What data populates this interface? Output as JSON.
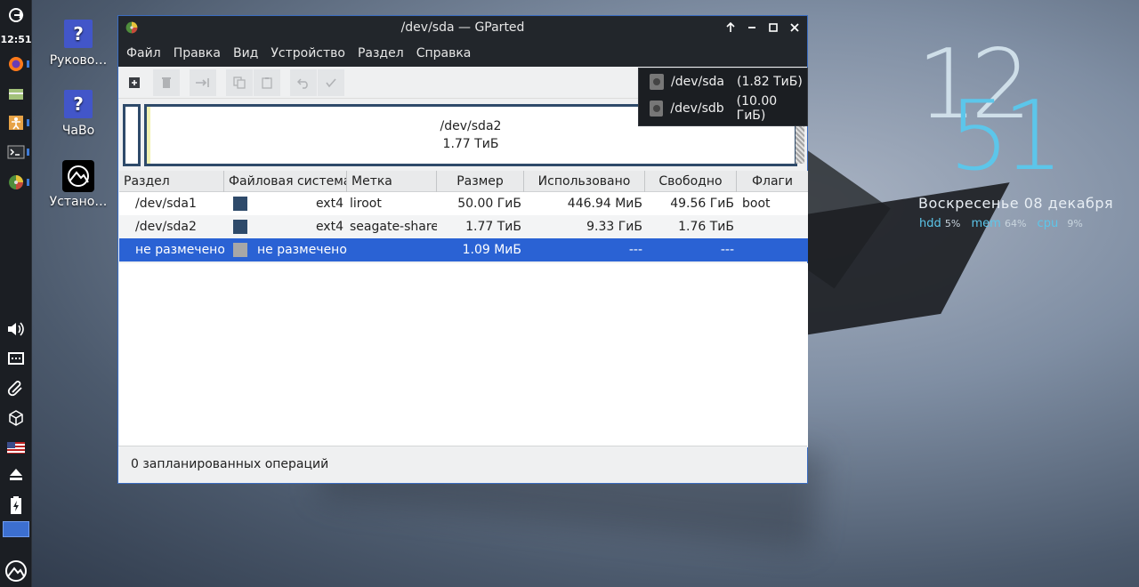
{
  "panel": {
    "clock": "12:51",
    "icons": [
      "logout-icon",
      "firefox-icon",
      "file-manager-icon",
      "accessibility-icon",
      "terminal-icon",
      "gparted-icon",
      "volume-icon",
      "network-icon",
      "clipboard-icon",
      "package-icon",
      "keyboard-layout-flag-icon",
      "eject-icon",
      "battery-icon",
      "workspace-icon",
      "distro-logo-icon"
    ]
  },
  "desktop": {
    "icons": [
      {
        "label": "Руково…",
        "icon": "help-icon"
      },
      {
        "label": "ЧаВо",
        "icon": "help-icon"
      },
      {
        "label": "Устано…",
        "icon": "installer-icon"
      }
    ]
  },
  "window": {
    "title": "/dev/sda — GParted",
    "menu": [
      "Файл",
      "Правка",
      "Вид",
      "Устройство",
      "Раздел",
      "Справка"
    ],
    "disk_map": {
      "partition_name": "/dev/sda2",
      "partition_size": "1.77 ТиБ"
    },
    "table": {
      "headers": [
        "Раздел",
        "Файловая система",
        "Метка",
        "Размер",
        "Использовано",
        "Свободно",
        "Флаги"
      ],
      "rows": [
        {
          "partition": "/dev/sda1",
          "fs": "ext4",
          "label": "liroot",
          "size": "50.00 ГиБ",
          "used": "446.94 МиБ",
          "free": "49.56 ГиБ",
          "flags": "boot"
        },
        {
          "partition": "/dev/sda2",
          "fs": "ext4",
          "label": "seagate-share",
          "size": "1.77 ТиБ",
          "used": "9.33 ГиБ",
          "free": "1.76 ТиБ",
          "flags": ""
        },
        {
          "partition": "не размечено",
          "fs": "не размечено",
          "label": "",
          "size": "1.09 МиБ",
          "used": "---",
          "free": "---",
          "flags": ""
        }
      ]
    },
    "status": "0 запланированных операций"
  },
  "device_menu": {
    "items": [
      {
        "device": "/dev/sda",
        "size": "(1.82 ТиБ)"
      },
      {
        "device": "/dev/sdb",
        "size": "(10.00 ГиБ)"
      }
    ]
  },
  "conky": {
    "hour": "12",
    "minute": "51",
    "date": "Воскресенье  08 декабря",
    "hdd_label": "hdd",
    "hdd": "5%",
    "mem_label": "mem",
    "mem": "64%",
    "cpu_label": "cpu",
    "cpu": "9%"
  },
  "colors": {
    "panel_bg": "#1b1e23",
    "titlebar_bg": "#22262b",
    "selection": "#2a62d4",
    "ext4": "#2e4a6a",
    "unallocated": "#a7a7a7",
    "conky_accent": "#5cc6ea"
  }
}
